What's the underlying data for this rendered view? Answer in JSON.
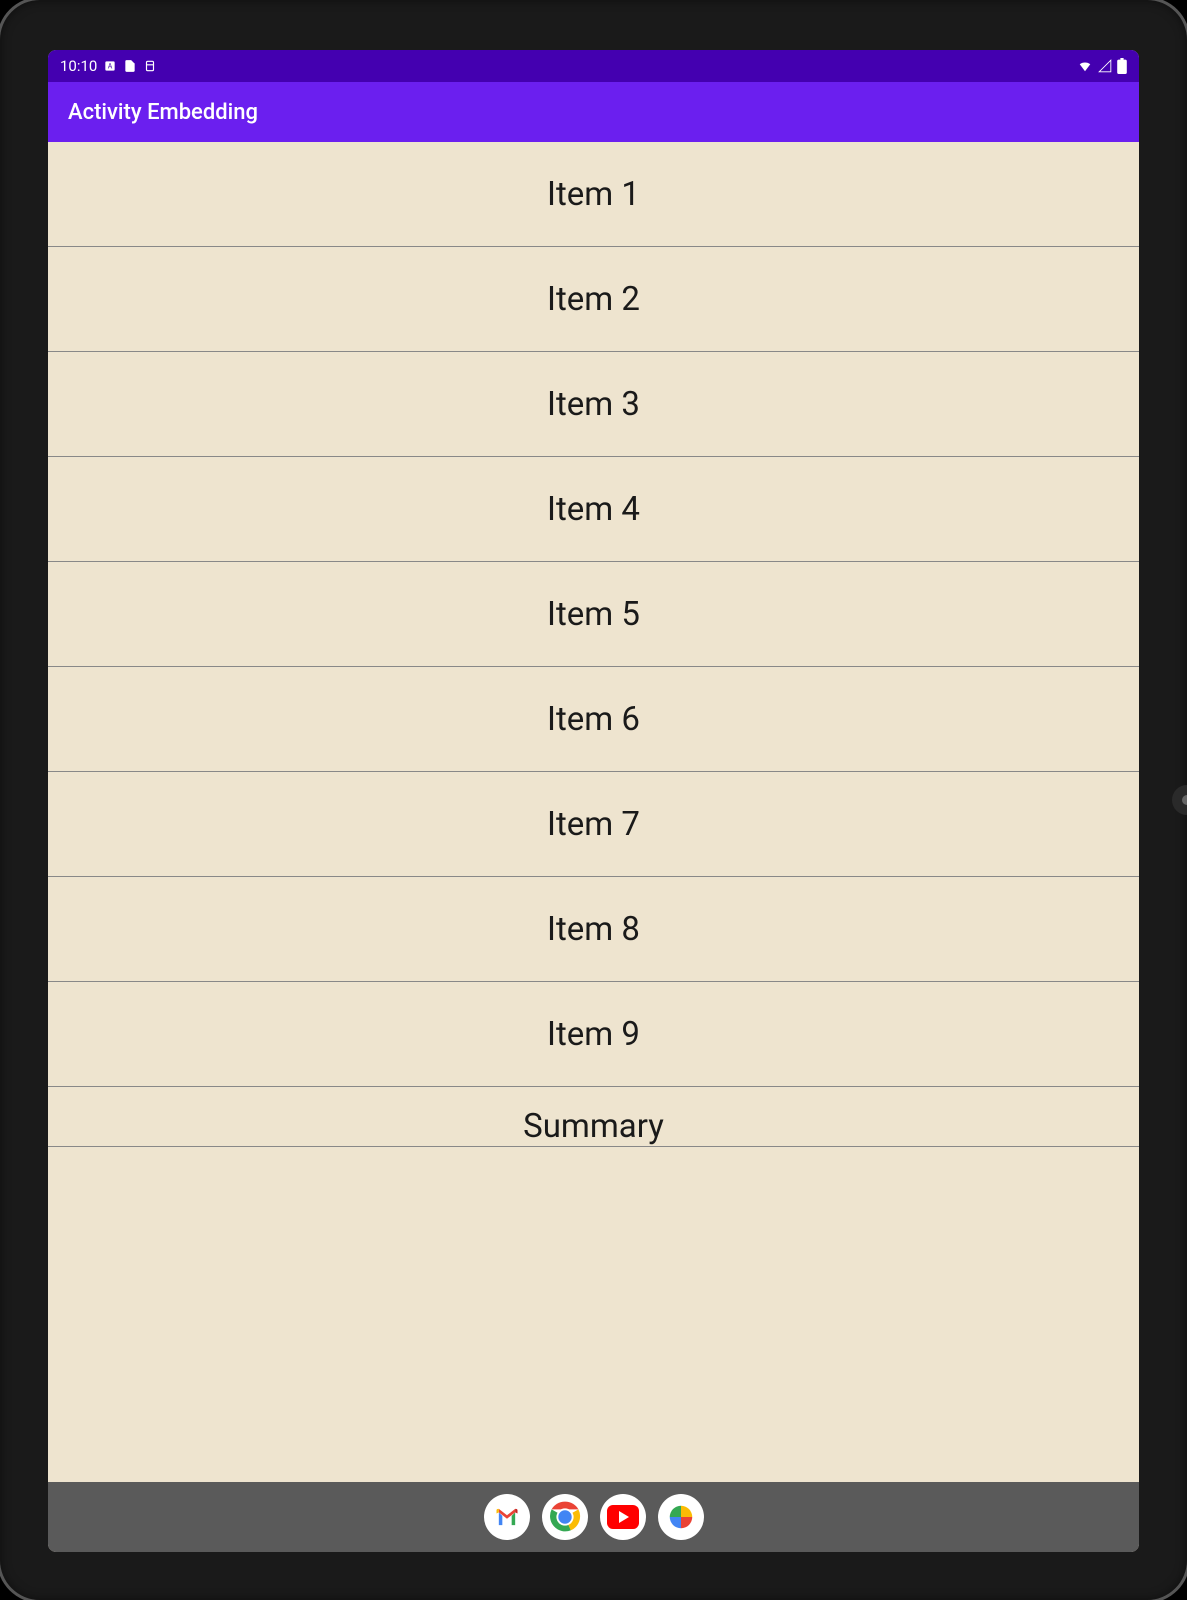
{
  "status_bar": {
    "time": "10:10"
  },
  "app_bar": {
    "title": "Activity Embedding"
  },
  "list": {
    "items": [
      "Item 1",
      "Item 2",
      "Item 3",
      "Item 4",
      "Item 5",
      "Item 6",
      "Item 7",
      "Item 8",
      "Item 9",
      "Summary"
    ]
  },
  "nav_bar": {
    "icons": [
      "gmail",
      "chrome",
      "youtube",
      "photos"
    ]
  }
}
